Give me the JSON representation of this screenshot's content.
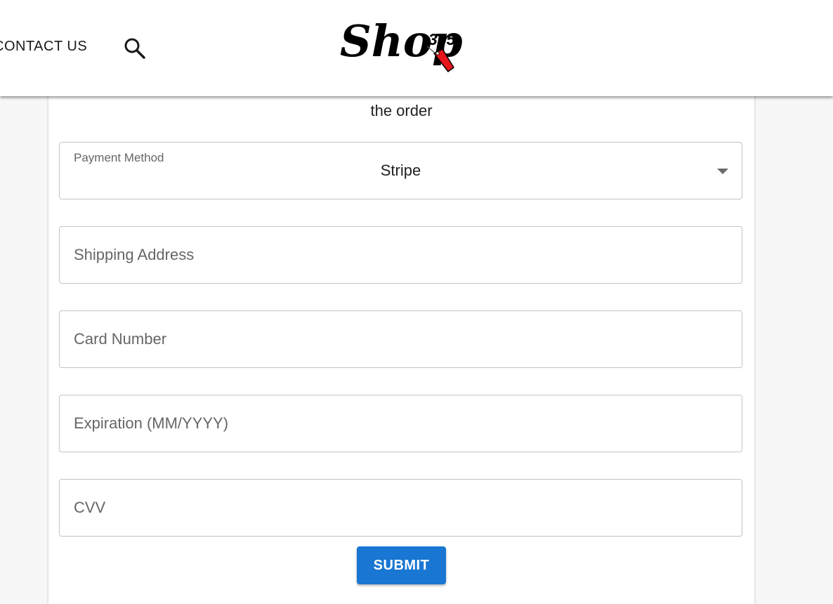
{
  "header": {
    "nav_link": "CONTACT US",
    "logo_text": "Shop",
    "logo_superscript": "365",
    "search_icon": "search-icon",
    "tag_icon": "price-tag-icon"
  },
  "form": {
    "subtitle": "the order",
    "payment_method": {
      "label": "Payment Method",
      "value": "Stripe",
      "icon": "dropdown-arrow-icon"
    },
    "shipping_address": {
      "placeholder": "Shipping Address"
    },
    "card_number": {
      "placeholder": "Card Number"
    },
    "expiration": {
      "placeholder": "Expiration (MM/YYYY)"
    },
    "cvv": {
      "placeholder": "CVV"
    },
    "submit_label": "SUBMIT"
  },
  "colors": {
    "accent": "#1976d2",
    "tag": "#e8141b"
  }
}
